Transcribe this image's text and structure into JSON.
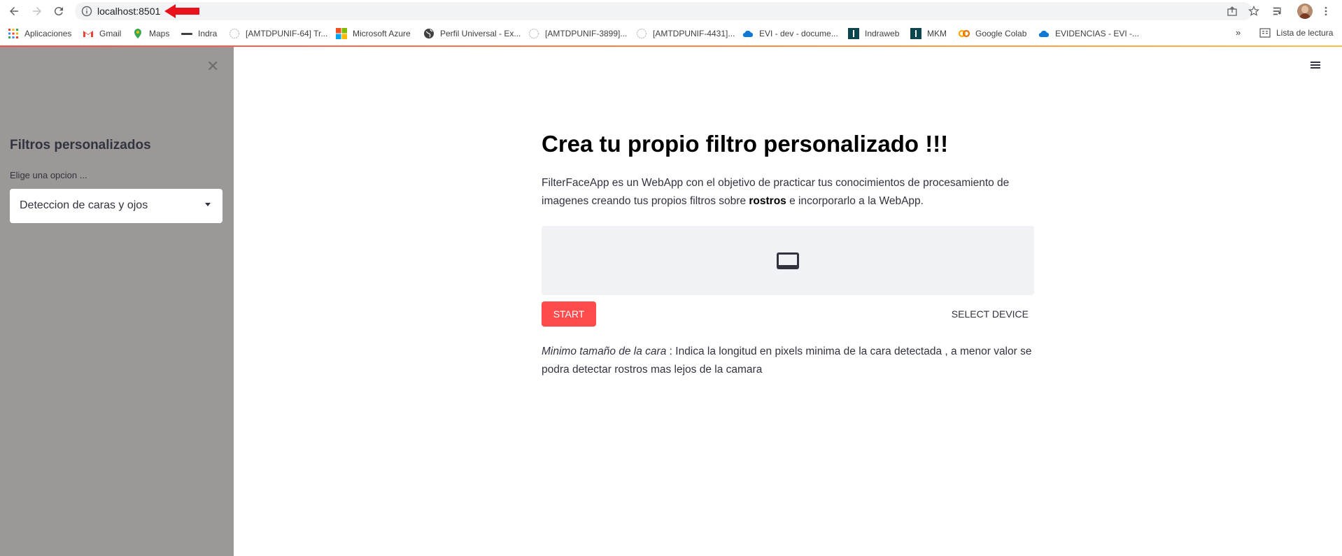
{
  "browser": {
    "url": "localhost:8501",
    "bookmarks": [
      {
        "label": "Aplicaciones",
        "icon": "apps-grid-icon"
      },
      {
        "label": "Gmail",
        "icon": "gmail-icon"
      },
      {
        "label": "Maps",
        "icon": "maps-pin-icon"
      },
      {
        "label": "Indra",
        "icon": "indra-logo-icon"
      },
      {
        "label": "[AMTDPUNIF-64] Tr...",
        "icon": "jira-globe-icon"
      },
      {
        "label": "Microsoft Azure",
        "icon": "microsoft-icon"
      },
      {
        "label": "Perfil Universal - Ex...",
        "icon": "globe-icon"
      },
      {
        "label": "[AMTDPUNIF-3899]...",
        "icon": "jira-globe-icon"
      },
      {
        "label": "[AMTDPUNIF-4431]...",
        "icon": "jira-globe-icon"
      },
      {
        "label": "EVI - dev - docume...",
        "icon": "onedrive-cloud-icon"
      },
      {
        "label": "Indraweb",
        "icon": "indraweb-icon"
      },
      {
        "label": "MKM",
        "icon": "indraweb-icon"
      },
      {
        "label": "Google Colab",
        "icon": "colab-icon"
      },
      {
        "label": "EVIDENCIAS - EVI -...",
        "icon": "onedrive-cloud-icon"
      }
    ],
    "more_label": "»",
    "reading_list_label": "Lista de lectura"
  },
  "sidebar": {
    "close_icon": "close-icon",
    "title": "Filtros personalizados",
    "select_label": "Elige una opcion ...",
    "select_value": "Deteccion de caras y ojos"
  },
  "main": {
    "title": "Crea tu propio filtro personalizado !!!",
    "intro_part1": "FilterFaceApp es un WebApp con el objetivo de practicar tus conocimientos de procesamiento de imagenes creando tus propios filtros sobre ",
    "intro_bold": "rostros",
    "intro_part2": " e incorporarlo a la WebApp.",
    "camera_icon": "video-camera-icon",
    "start_label": "START",
    "select_device_label": "SELECT DEVICE",
    "note_italic": "Minimo tamaño de la cara",
    "note_text": " : Indica la longitud en pixels minima de la cara detectada , a menor valor se podra detectar rostros mas lejos de la camara"
  },
  "colors": {
    "sidebar_bg": "#9c9898",
    "primary": "#ff4b4b",
    "camera_box_bg": "#f0f2f6",
    "annotation_arrow": "#e8121c"
  }
}
